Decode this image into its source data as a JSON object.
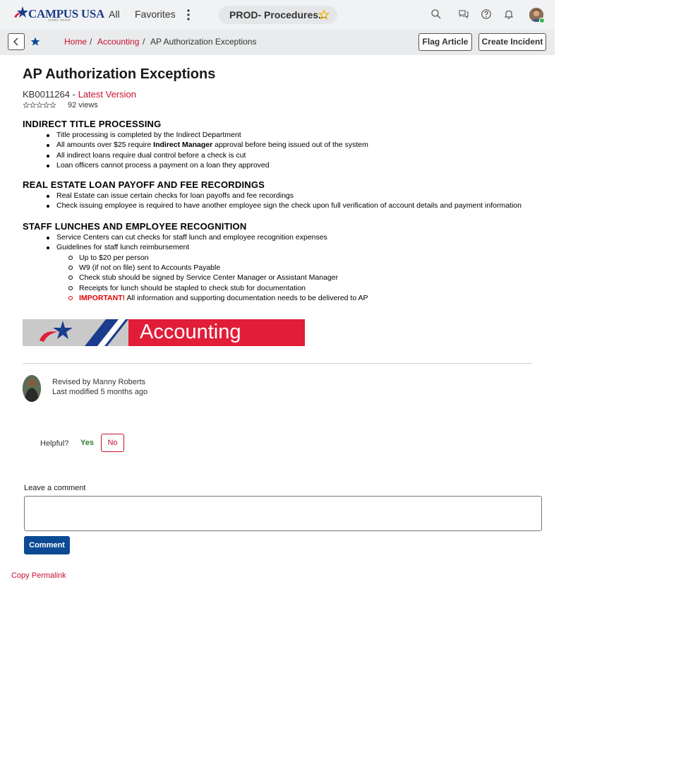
{
  "header": {
    "logo_text": "CAMPUS USA",
    "logo_sub": "credit union",
    "nav_all": "All",
    "nav_favorites": "Favorites",
    "tab_title": "PROD- Procedures...",
    "icons": [
      "search-icon",
      "chat-icon",
      "help-icon",
      "bell-icon",
      "avatar"
    ]
  },
  "subbar": {
    "breadcrumbs": [
      "Home",
      "Accounting",
      "AP Authorization Exceptions"
    ],
    "flag_article": "Flag Article",
    "create_incident": "Create Incident"
  },
  "article": {
    "title": "AP Authorization Exceptions",
    "number": "KB0011264",
    "dash": "-",
    "version": "Latest Version",
    "views": "92 views",
    "rating_stars": 0,
    "sections": [
      {
        "heading": "INDIRECT TITLE PROCESSING",
        "items": [
          "Title processing is completed by the Indirect Department",
          "All indirect loans require dual control before a check is cut",
          "Loan officers cannot process a payment on a loan they approved"
        ],
        "item2_pre": "All amounts over $25 require ",
        "item2_bold": "Indirect Manager",
        "item2_post": " approval before being issued out of the system"
      },
      {
        "heading": "REAL ESTATE LOAN PAYOFF AND FEE RECORDINGS",
        "items": [
          "Real Estate can issue certain checks for loan payoffs and fee recordings",
          "Check issuing employee is required to have another employee sign the check upon full verification of account details and payment information"
        ]
      },
      {
        "heading": "STAFF LUNCHES AND EMPLOYEE RECOGNITION",
        "items": [
          "Service Centers can cut checks for staff lunch and employee recognition expenses",
          "Guidelines for staff lunch reimbursement"
        ],
        "subitems": [
          "Up to $20 per person",
          "W9 (if not on file) sent to Accounts Payable",
          "Check stub should be signed by Service Center Manager or Assistant Manager",
          "Receipts for lunch should be stapled to check stub for documentation"
        ],
        "important_label": "IMPORTANT!",
        "important_text": " All information and supporting documentation needs to be delivered to AP"
      }
    ],
    "banner_text": "Accounting"
  },
  "revision": {
    "revised_by": "Revised by Manny Roberts",
    "last_modified": "Last modified 5 months ago"
  },
  "feedback": {
    "helpful": "Helpful?",
    "yes": "Yes",
    "no": "No"
  },
  "comment": {
    "label": "Leave a comment",
    "button": "Comment",
    "value": ""
  },
  "permalink": "Copy Permalink",
  "colors": {
    "brand_red": "#c8102e",
    "brand_blue": "#0c4a94",
    "yes_green": "#2e7d32",
    "important_red": "#e00000"
  }
}
